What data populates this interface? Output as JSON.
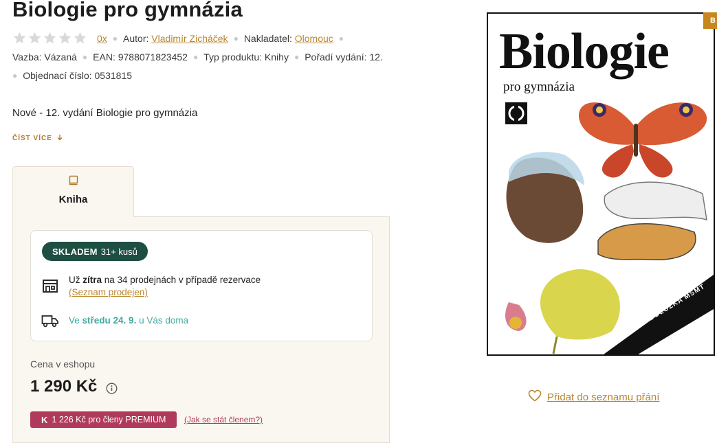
{
  "product": {
    "title": "Biologie pro gymnázia",
    "rating_count": "0x",
    "author_label": "Autor:",
    "author": "Vladimír Zicháček",
    "publisher_label": "Nakladatel:",
    "publisher": "Olomouc",
    "binding": "Vazba: Vázaná",
    "ean": "EAN: 9788071823452",
    "product_type": "Typ produktu: Knihy",
    "edition": "Pořadí vydání: 12.",
    "order_number": "Objednací číslo: 0531815",
    "rating_stars": 0,
    "rating_max": 5
  },
  "description": {
    "text": "Nové - 12. vydání Biologie pro gymnázia",
    "read_more": "ČÍST VÍCE"
  },
  "tab": {
    "label": "Kniha",
    "icon": "book-icon"
  },
  "availability": {
    "badge_strong": "SKLADEM",
    "badge_rest": "31+ kusů",
    "store_prefix": "Už ",
    "store_bold": "zítra",
    "store_suffix": " na 34 prodejnách v případě rezervace",
    "store_link": "(Seznam prodejen)",
    "delivery_prefix": "Ve ",
    "delivery_bold": "středu 24. 9.",
    "delivery_suffix": " u Vás doma"
  },
  "pricing": {
    "label": "Cena v eshopu",
    "price": "1 290 Kč",
    "premium_logo": "K",
    "premium_text": "1 226 Kč pro členy PREMIUM",
    "member_link": "(Jak se stát členem?)"
  },
  "cover": {
    "title": "Biologie",
    "subtitle": "pro gymnázia",
    "ribbon": "DOLOŽKA MŠMT",
    "corner_badge": "B"
  },
  "wishlist": {
    "label": "Přidat do seznamu přání",
    "icon": "heart-icon"
  },
  "colors": {
    "accent": "#b8862e",
    "stock_badge": "#1f4e42",
    "delivery": "#3fa9a0",
    "premium": "#b03a5b",
    "panel": "#faf6f0"
  }
}
